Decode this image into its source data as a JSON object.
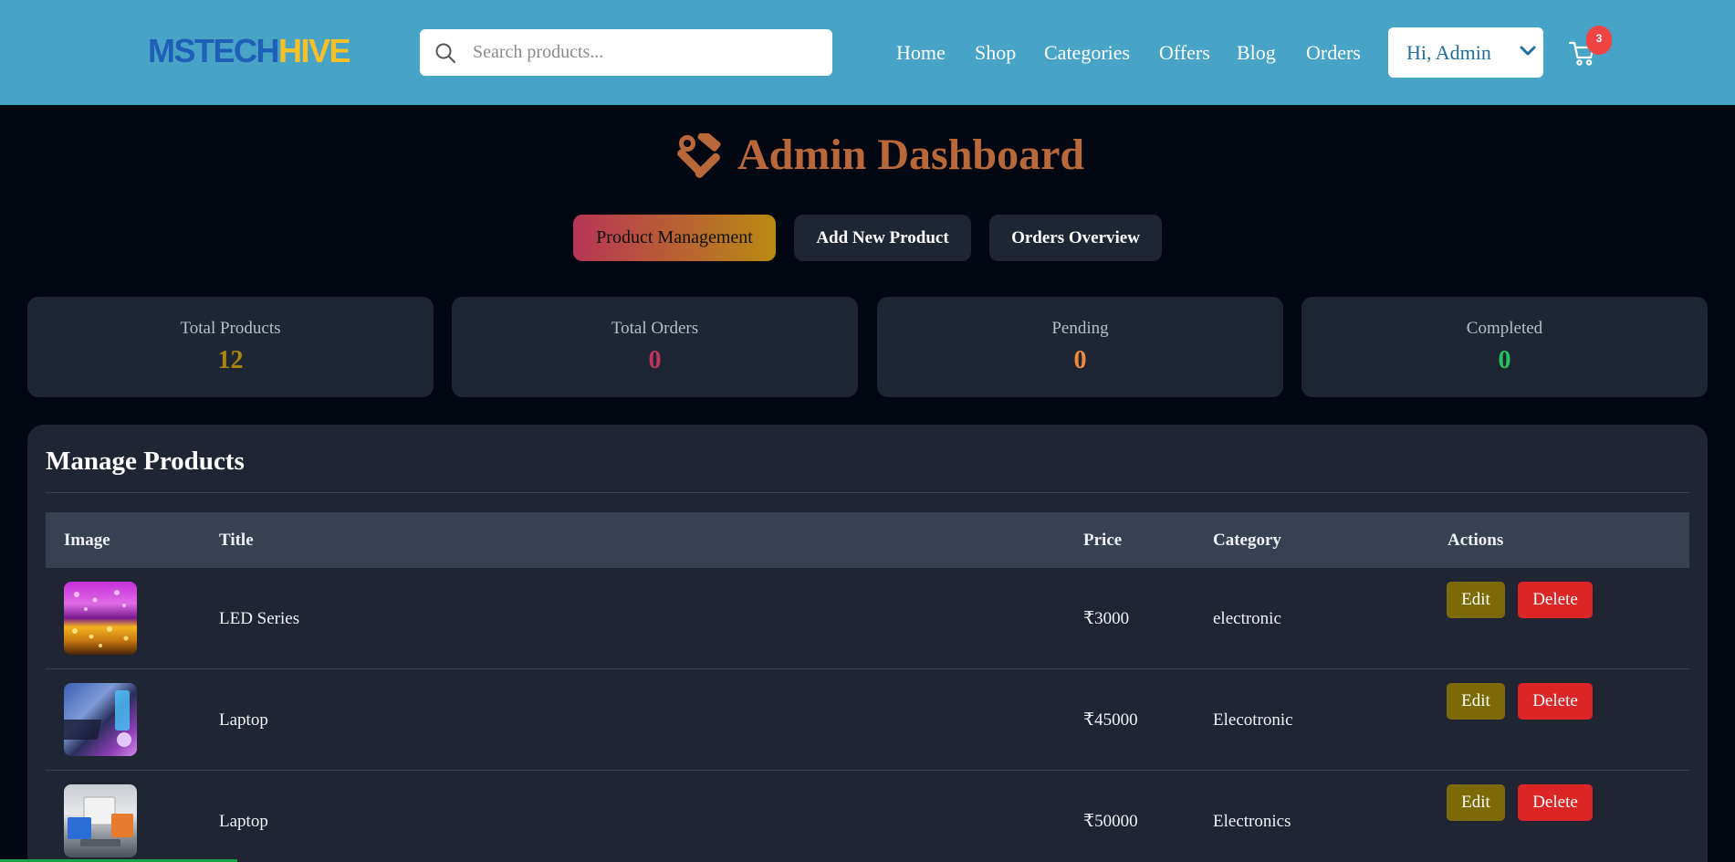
{
  "header": {
    "logo_part1": "MSTECH",
    "logo_part2": "HIVE",
    "search_placeholder": "Search products...",
    "nav": [
      "Home",
      "Shop",
      "Categories",
      "Offers",
      "Blog",
      "Orders"
    ],
    "user_label": "Hi, Admin",
    "cart_count": "3"
  },
  "page": {
    "title": "Admin Dashboard",
    "tabs": [
      "Product Management",
      "Add New Product",
      "Orders Overview"
    ],
    "active_tab": "Product Management"
  },
  "stats": [
    {
      "label": "Total Products",
      "value": "12",
      "color": "#a7860f"
    },
    {
      "label": "Total Orders",
      "value": "0",
      "color": "#c1365c"
    },
    {
      "label": "Pending",
      "value": "0",
      "color": "#f08a3a"
    },
    {
      "label": "Completed",
      "value": "0",
      "color": "#22c55e"
    }
  ],
  "products": {
    "title": "Manage Products",
    "columns": [
      "Image",
      "Title",
      "Price",
      "Category",
      "Actions"
    ],
    "rows": [
      {
        "title": "LED Series",
        "price": "₹3000",
        "category": "electronic",
        "thumb": "led-lights-image"
      },
      {
        "title": "Laptop",
        "price": "₹45000",
        "category": "Elecotronic",
        "thumb": "gaming-laptop-image"
      },
      {
        "title": "Laptop",
        "price": "₹50000",
        "category": "Electronics",
        "thumb": "macbook-laptops-image"
      }
    ],
    "edit_label": "Edit",
    "delete_label": "Delete"
  },
  "colors": {
    "header_bg": "#47a4c6",
    "page_bg": "#030712",
    "card_bg": "#1e2533",
    "title_color": "#b9683a",
    "edit_btn": "#7c6a06",
    "delete_btn": "#dc2626"
  }
}
